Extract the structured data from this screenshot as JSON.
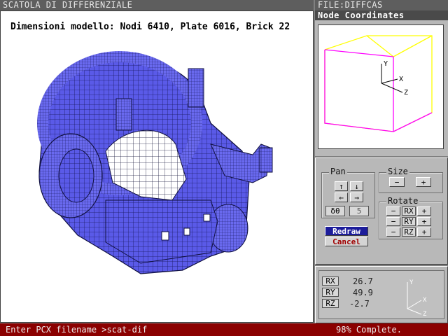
{
  "main_title": "SCATOLA DI DIFFERENZIALE",
  "file_title": "FILE:DIFFCAS",
  "nodecoords_title": "Node Coordinates",
  "model_caption": "Dimensioni modello: Nodi 6410, Plate 6016, Brick 22",
  "mini_axes": {
    "y": "Y",
    "x": "X",
    "z": "Z"
  },
  "controls": {
    "pan_label": "Pan",
    "size_label": "Size",
    "rotate_label": "Rotate",
    "pan_up": "↑",
    "pan_down": "↓",
    "pan_left": "←",
    "pan_right": "→",
    "size_minus": "−",
    "size_plus": "+",
    "delta_label": "δθ",
    "delta_value": "5",
    "rx_minus": "−",
    "rx_label": "RX",
    "rx_plus": "+",
    "ry_minus": "−",
    "ry_label": "RY",
    "ry_plus": "+",
    "rz_minus": "−",
    "rz_label": "RZ",
    "rz_plus": "+",
    "redraw": "Redraw",
    "cancel": "Cancel"
  },
  "readout": {
    "rx_label": "RX",
    "rx_value": "26.7",
    "ry_label": "RY",
    "ry_value": "49.9",
    "rz_label": "RZ",
    "rz_value": "-2.7"
  },
  "status": {
    "prompt": "Enter PCX filename >scat-dif",
    "progress_text": "98% Complete.",
    "progress": 0.98
  },
  "colors": {
    "mesh": "#5050e0",
    "status_bg": "#8b0000",
    "box_yellow": "#ffff00",
    "box_magenta": "#ff00ff"
  }
}
